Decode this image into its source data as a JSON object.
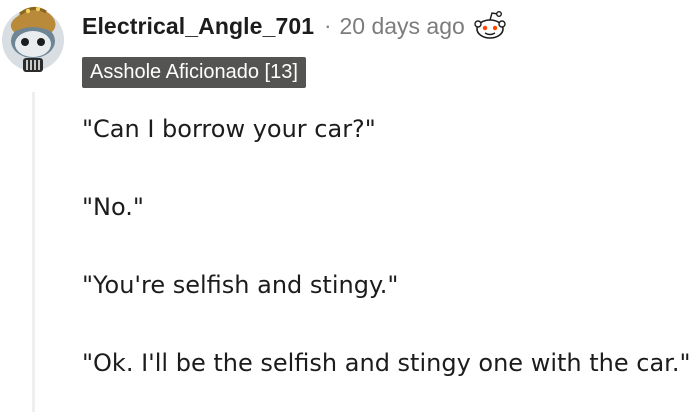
{
  "comment": {
    "username": "Electrical_Angle_701",
    "separator": "·",
    "timestamp": "20 days ago",
    "flair": "Asshole Aficionado [13]",
    "award_icon": "snoo-award-icon",
    "avatar_icon": "snoo-avatar-icon",
    "paragraphs": [
      "\"Can I borrow your car?\"",
      "\"No.\"",
      "\"You're selfish and stingy.\"",
      "\"Ok. I'll be the selfish and stingy one with the car.\""
    ]
  }
}
